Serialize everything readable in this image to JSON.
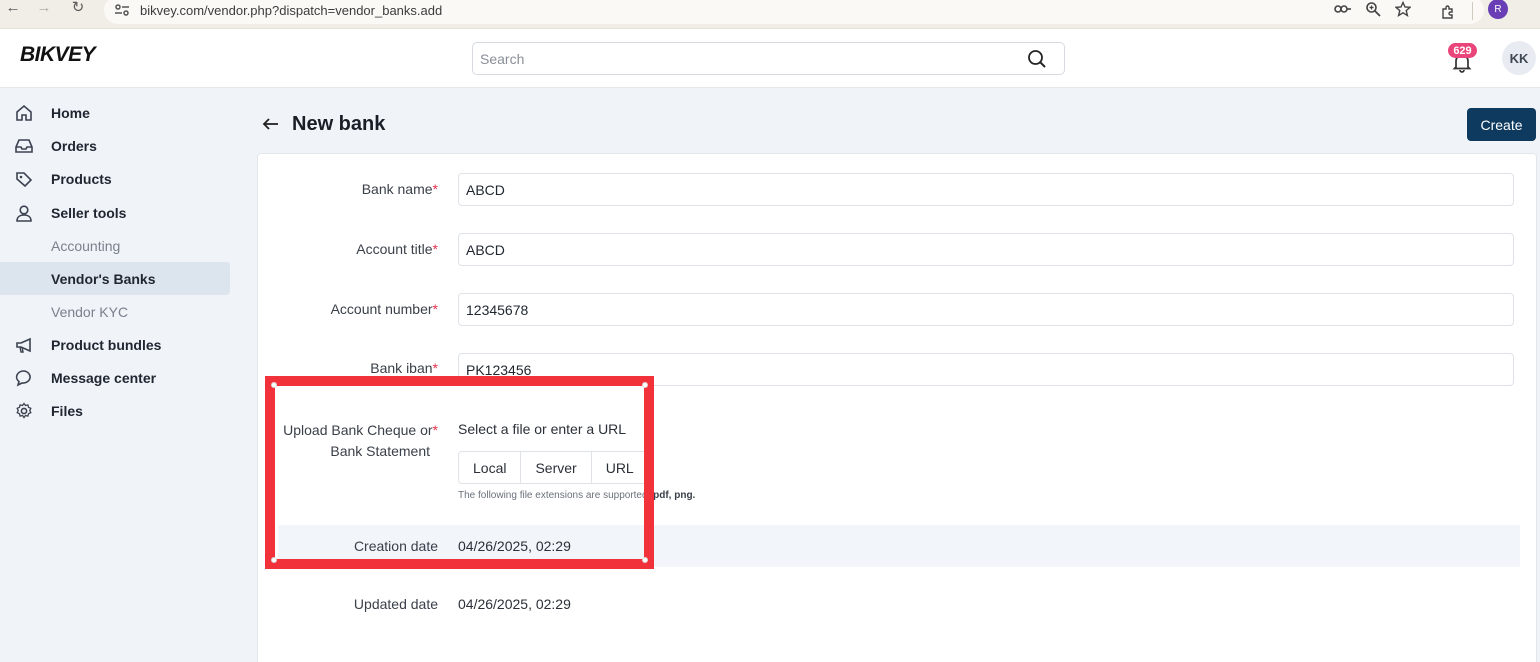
{
  "browser": {
    "url": "bikvey.com/vendor.php?dispatch=vendor_banks.add",
    "profile_initial": "R"
  },
  "header": {
    "logo": "BIKVEY",
    "search_placeholder": "Search",
    "notification_count": "629",
    "avatar_initials": "KK"
  },
  "sidebar": {
    "items": [
      {
        "label": "Home",
        "icon": "home-icon"
      },
      {
        "label": "Orders",
        "icon": "inbox-icon"
      },
      {
        "label": "Products",
        "icon": "tag-icon"
      },
      {
        "label": "Seller tools",
        "icon": "user-icon"
      },
      {
        "label": "Accounting",
        "icon": ""
      },
      {
        "label": "Vendor's Banks",
        "icon": "",
        "active": true
      },
      {
        "label": "Vendor KYC",
        "icon": ""
      },
      {
        "label": "Product bundles",
        "icon": "megaphone-icon"
      },
      {
        "label": "Message center",
        "icon": "chat-bubble-icon"
      },
      {
        "label": "Files",
        "icon": "gear-icon"
      }
    ]
  },
  "page": {
    "title": "New bank",
    "create_label": "Create"
  },
  "form": {
    "bank_name": {
      "label": "Bank name",
      "value": "ABCD"
    },
    "account_title": {
      "label": "Account title",
      "value": "ABCD"
    },
    "account_number": {
      "label": "Account number",
      "value": "12345678"
    },
    "bank_iban": {
      "label": "Bank iban",
      "value": "PK123456"
    },
    "upload": {
      "label_line1": "Upload Bank Cheque or",
      "label_line2": "Bank Statement",
      "hint": "Select a file or enter a URL",
      "buttons": [
        "Local",
        "Server",
        "URL"
      ],
      "extensions_note": "The following file extensions are supported:",
      "extensions": "pdf, png."
    },
    "required_mark": "*",
    "creation_date": {
      "label": "Creation date",
      "value": "04/26/2025, 02:29"
    },
    "updated_date": {
      "label": "Updated date",
      "value": "04/26/2025, 02:29"
    }
  },
  "colors": {
    "primary_button": "#0f3a5f",
    "badge": "#e9457b",
    "required": "#e0314b",
    "annotation": "#f2323b"
  }
}
